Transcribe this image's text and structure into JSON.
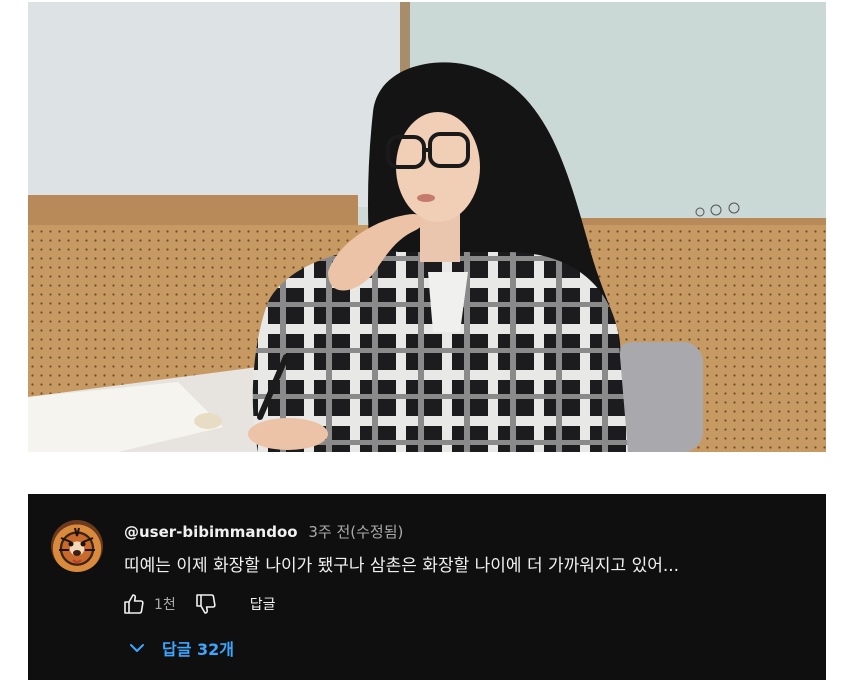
{
  "comment": {
    "author_handle": "@user-bibimmandoo",
    "timestamp": "3주 전(수정됨)",
    "text": "띠예는 이제 화장할 나이가 됐구나 삼촌은 화장할 나이에 더 가까워지고 있어...",
    "like_count": "1천",
    "reply_label": "답글",
    "replies_toggle_label": "답글 32개"
  },
  "icons": {
    "like": "thumbs-up-icon",
    "dislike": "thumbs-down-icon",
    "expand": "chevron-down-icon",
    "avatar": "tiger-avatar"
  },
  "colors": {
    "panel_bg": "#0f0f0f",
    "text_primary": "#f1f1f1",
    "text_secondary": "#aaaaaa",
    "link_blue": "#3ea6ff"
  }
}
